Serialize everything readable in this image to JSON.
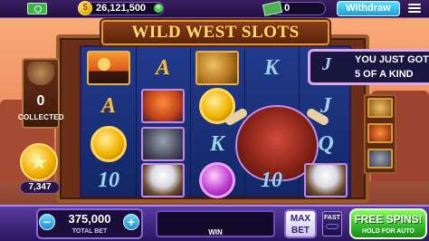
{
  "topbar": {
    "coins": "26,121,500",
    "coin_symbol": "$",
    "coin_plus": "+",
    "cash": "0",
    "withdraw_label": "Withdraw"
  },
  "game": {
    "title": "WILD WEST SLOTS"
  },
  "collect": {
    "count": "0",
    "label": "COLLECTED"
  },
  "star": {
    "symbol": "★",
    "value": "7,347"
  },
  "toast": {
    "icon_letter": "J",
    "line1": "YOU JUST GOT",
    "line2": "5 OF A KIND"
  },
  "reels": {
    "letters": {
      "r1c2": "A",
      "r1c4": "K",
      "r2c1": "A",
      "r2c5": "J",
      "r3c3": "K",
      "r3c5": "Q",
      "r4c1": "10",
      "r4c5": "10"
    }
  },
  "bottombar": {
    "minus": "−",
    "plus": "+",
    "bet_value": "375,000",
    "bet_label": "TOTAL BET",
    "win_label": "WIN",
    "maxbet_line1": "MAX",
    "maxbet_line2": "BET",
    "fast_label": "FAST",
    "spin_label": "FREE SPINS!",
    "spin_sub": "HOLD FOR AUTO"
  },
  "colors": {
    "accent": "#8a6ad8",
    "spin_green": "#2fb82a",
    "gold": "#ffe17a"
  }
}
